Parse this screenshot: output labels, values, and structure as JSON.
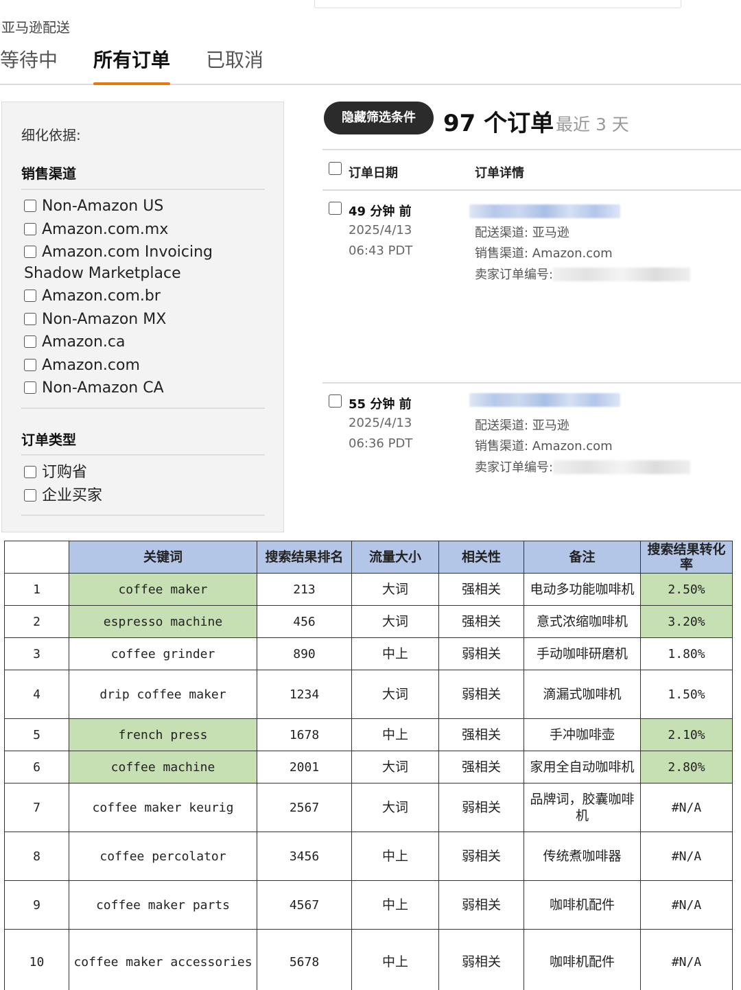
{
  "header": {
    "title": "亚马逊配送",
    "tabs": [
      {
        "label": "等待中",
        "active": false
      },
      {
        "label": "所有订单",
        "active": true
      },
      {
        "label": "已取消",
        "active": false
      }
    ]
  },
  "filters": {
    "refine_label": "细化依据:",
    "sales_channel": {
      "title": "销售渠道",
      "options": [
        "Non-Amazon US",
        "Amazon.com.mx",
        "Amazon.com Invoicing Shadow Marketplace",
        "Amazon.com.br",
        "Non-Amazon MX",
        "Amazon.ca",
        "Amazon.com",
        "Non-Amazon CA"
      ]
    },
    "order_type": {
      "title": "订单类型",
      "options": [
        "订购省",
        "企业买家"
      ]
    }
  },
  "orders": {
    "hide_filters_label": "隐藏筛选条件",
    "count_label": "97 个订单",
    "range_label": "最近 3 天",
    "columns": {
      "date": "订单日期",
      "details": "订单详情"
    },
    "items": [
      {
        "ago": "49 分钟 前",
        "date": "2025/4/13",
        "time": "06:43 PDT",
        "fulfillment": "配送渠道: 亚马逊",
        "sales_channel": "销售渠道: Amazon.com",
        "seller_order_label": "卖家订单编号:"
      },
      {
        "ago": "55 分钟 前",
        "date": "2025/4/13",
        "time": "06:36 PDT",
        "fulfillment": "配送渠道: 亚马逊",
        "sales_channel": "销售渠道: Amazon.com",
        "seller_order_label": "卖家订单编号:"
      }
    ]
  },
  "keyword_table": {
    "headers": [
      "关键词",
      "搜索结果排名",
      "流量大小",
      "相关性",
      "备注",
      "搜索结果转化率"
    ],
    "rows": [
      {
        "no": "1",
        "keyword": "coffee maker",
        "rank": "213",
        "traffic": "大词",
        "relevance": "强相关",
        "note": "电动多功能咖啡机",
        "conversion": "2.50%",
        "highlight": true
      },
      {
        "no": "2",
        "keyword": "espresso machine",
        "rank": "456",
        "traffic": "大词",
        "relevance": "强相关",
        "note": "意式浓缩咖啡机",
        "conversion": "3.20%",
        "highlight": true
      },
      {
        "no": "3",
        "keyword": "coffee grinder",
        "rank": "890",
        "traffic": "中上",
        "relevance": "弱相关",
        "note": "手动咖啡研磨机",
        "conversion": "1.80%",
        "highlight": false
      },
      {
        "no": "4",
        "keyword": "drip coffee maker",
        "rank": "1234",
        "traffic": "大词",
        "relevance": "弱相关",
        "note": "滴漏式咖啡机",
        "conversion": "1.50%",
        "highlight": false
      },
      {
        "no": "5",
        "keyword": "french press",
        "rank": "1678",
        "traffic": "中上",
        "relevance": "强相关",
        "note": "手冲咖啡壶",
        "conversion": "2.10%",
        "highlight": true
      },
      {
        "no": "6",
        "keyword": "coffee machine",
        "rank": "2001",
        "traffic": "大词",
        "relevance": "强相关",
        "note": "家用全自动咖啡机",
        "conversion": "2.80%",
        "highlight": true
      },
      {
        "no": "7",
        "keyword": "coffee maker keurig",
        "rank": "2567",
        "traffic": "大词",
        "relevance": "弱相关",
        "note": "品牌词，胶囊咖啡机",
        "conversion": "#N/A",
        "highlight": false
      },
      {
        "no": "8",
        "keyword": "coffee percolator",
        "rank": "3456",
        "traffic": "中上",
        "relevance": "弱相关",
        "note": "传统煮咖啡器",
        "conversion": "#N/A",
        "highlight": false
      },
      {
        "no": "9",
        "keyword": "coffee maker parts",
        "rank": "4567",
        "traffic": "中上",
        "relevance": "弱相关",
        "note": "咖啡机配件",
        "conversion": "#N/A",
        "highlight": false
      },
      {
        "no": "10",
        "keyword": "coffee maker accessories",
        "rank": "5678",
        "traffic": "中上",
        "relevance": "弱相关",
        "note": "咖啡机配件",
        "conversion": "#N/A",
        "highlight": false
      }
    ]
  },
  "colors": {
    "accent_orange": "#e47911",
    "header_blue": "#b4c6e7",
    "highlight_green": "#c6e0b4"
  }
}
